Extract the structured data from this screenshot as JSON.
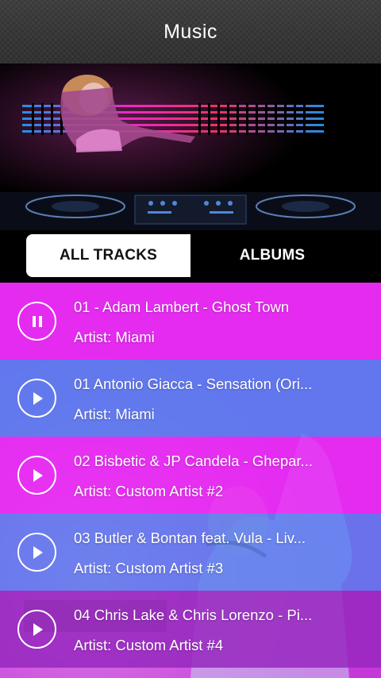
{
  "app": {
    "title": "Music"
  },
  "tabs": [
    {
      "label": "ALL TRACKS",
      "active": true
    },
    {
      "label": "ALBUMS",
      "active": false
    }
  ],
  "colors": {
    "magenta": "#e51ff0",
    "blue": "#4a86e8",
    "purple": "#8b2fb8",
    "topbar": "#333333"
  },
  "tracks": [
    {
      "title": "01 - Adam Lambert - Ghost Town",
      "artist": "Artist: Miami",
      "state": "playing",
      "icon": "pause-icon"
    },
    {
      "title": "01 Antonio Giacca - Sensation (Ori...",
      "artist": "Artist: Miami",
      "state": "stopped",
      "icon": "play-icon"
    },
    {
      "title": "02 Bisbetic & JP Candela - Ghepar...",
      "artist": "Artist: Custom Artist #2",
      "state": "stopped",
      "icon": "play-icon"
    },
    {
      "title": "03 Butler & Bontan feat. Vula - Liv...",
      "artist": "Artist: Custom Artist #3",
      "state": "stopped",
      "icon": "play-icon"
    },
    {
      "title": "04 Chris Lake & Chris Lorenzo - Pi...",
      "artist": "Artist: Custom Artist #4",
      "state": "stopped",
      "icon": "play-icon"
    }
  ]
}
